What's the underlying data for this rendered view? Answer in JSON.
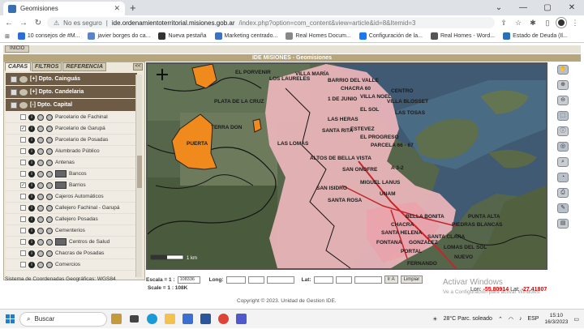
{
  "browser": {
    "tab_title": "Geomisiones",
    "new_tab": "+",
    "window_controls": [
      "⌄",
      "—",
      "▢",
      "✕"
    ],
    "security_warning": "No es seguro",
    "url_host": "ide.ordenamientoterritorial.misiones.gob.ar",
    "url_path": "/index.php?option=com_content&view=article&id=8&Itemid=3",
    "bookmarks": [
      {
        "label": "10 consejos de #M...",
        "color": "#2d6bd9"
      },
      {
        "label": "javier borges do ca...",
        "color": "#5b84c6"
      },
      {
        "label": "Nueva pestaña",
        "color": "#333333"
      },
      {
        "label": "Marketing centrado...",
        "color": "#3a73c4"
      },
      {
        "label": "Real Homes Docum...",
        "color": "#888888"
      },
      {
        "label": "Configuración de la...",
        "color": "#1877f2"
      },
      {
        "label": "Real Homes - Word...",
        "color": "#555555"
      },
      {
        "label": "Estado de Deuda (Il...",
        "color": "#2a6fb7"
      }
    ]
  },
  "page": {
    "inicio": "INICIO",
    "title": "IDE MISIONES - Geomisiones",
    "tabs": [
      "CAPAS",
      "FILTROS",
      "REFERENCIA"
    ],
    "collapse": "<<",
    "groups": [
      {
        "label": "[+] Dpto. Cainguás"
      },
      {
        "label": "[+] Dpto. Candelaria"
      },
      {
        "label": "[-] Dpto. Capital"
      }
    ],
    "layers": [
      {
        "label": "Parcelario de Fachinal",
        "checked": ""
      },
      {
        "label": "Parcelario de Garupá",
        "checked": "✓"
      },
      {
        "label": "Parcelario de Posadas",
        "checked": ""
      },
      {
        "label": "Alumbrado Público",
        "checked": ""
      },
      {
        "label": "Antenas",
        "checked": ""
      },
      {
        "label": "Bancos",
        "checked": ""
      },
      {
        "label": "Barrios",
        "checked": "✓"
      },
      {
        "label": "Cajeros Automáticos",
        "checked": ""
      },
      {
        "label": "Callejero Fachinal - Garupá",
        "checked": ""
      },
      {
        "label": "Callejero Posadas",
        "checked": ""
      },
      {
        "label": "Cementerios",
        "checked": ""
      },
      {
        "label": "Centros de Salud",
        "checked": ""
      },
      {
        "label": "Chacras de Posadas",
        "checked": ""
      },
      {
        "label": "Comercios",
        "checked": ""
      }
    ],
    "coord_system": "Sistema de Coordenadas Geográficas: WGS84",
    "scale_label": "Escala = 1 :",
    "scale_value": "108336",
    "long_label": "Long:",
    "lat_label": "Lat:",
    "go_button": "Ir A",
    "clear_button": "Limpiar",
    "scale_text": "Scale = 1 : 108K",
    "lon_label": "Lon:",
    "lon_value": "-55.80914",
    "lat_label2": "Lat:",
    "lat_value": "-27.41807",
    "watermark_line1": "Activar Windows",
    "watermark_line2": "Ve a Configuración para activar Windows.",
    "copyright": "Copyright © 2023. Unidad de Gestion IDE."
  },
  "map": {
    "labels": [
      "EL PORVENIR",
      "VILLA MARÍA",
      "BARRIO DEL VALLE",
      "CHACRA 60",
      "CENTRO",
      "1 DE JUNIO",
      "VILLA NOEL",
      "EL SOL",
      "VILLA BLOSSET",
      "LAS TOSAS",
      "LAS HERAS",
      "SANTA RITA",
      "EL PROGRESO",
      "ESTEVEZ",
      "PARCELA 66 - 67",
      "ALTOS DE BELLA VISTA",
      "SAN ONOFRE",
      "MIGUEL LANUS",
      "SAN ISIDRO",
      "UNAM",
      "SANTA ROSA",
      "PUNTA ALTA",
      "PIEDRAS BLANCAS",
      "SANTA CLARA",
      "BELLA BONITA",
      "CHACRA",
      "SANTA HELENA",
      "GONZALEZ",
      "FONTANA",
      "PORTAL",
      "LOMAS DEL SOL",
      "FERNANDO",
      "NUEVO",
      "PLATA DE LA CRUZ",
      "TERRA DON",
      "PUERTA",
      "A 3-2",
      "LAS LOMAS",
      "LOS LAURELES"
    ],
    "scalebar": "1 km"
  },
  "taskbar": {
    "search": "Buscar",
    "weather": "28°C  Parc. soleado",
    "lang": "ESP",
    "time": "15:10",
    "date": "16/3/2023"
  }
}
